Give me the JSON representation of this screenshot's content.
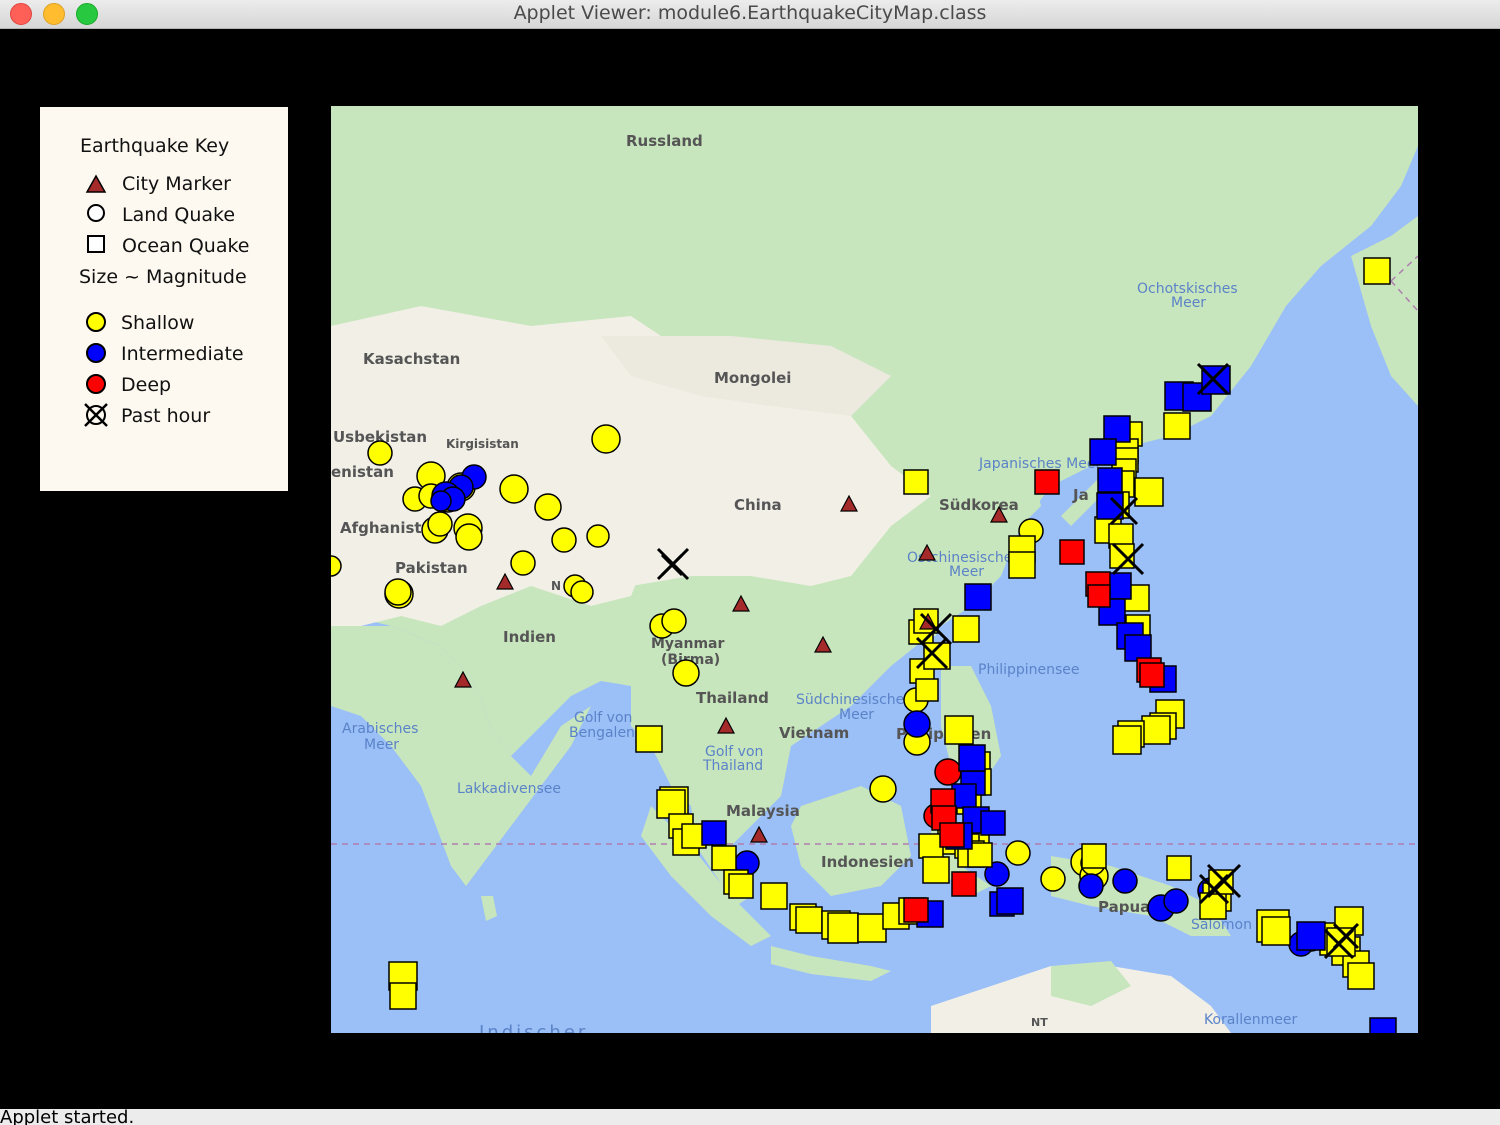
{
  "window": {
    "title": "Applet Viewer: module6.EarthquakeCityMap.class",
    "status": "Applet started."
  },
  "legend": {
    "title": "Earthquake Key",
    "items": [
      {
        "label": "City Marker",
        "icon": "city-marker-icon"
      },
      {
        "label": "Land Quake",
        "icon": "land-quake-icon"
      },
      {
        "label": "Ocean Quake",
        "icon": "ocean-quake-icon"
      }
    ],
    "size_label": "Size ~ Magnitude",
    "depth_items": [
      {
        "label": "Shallow",
        "color": "#ffff00"
      },
      {
        "label": "Intermediate",
        "color": "#0000ff"
      },
      {
        "label": "Deep",
        "color": "#ff0000"
      }
    ],
    "past_hour_label": "Past hour"
  },
  "map": {
    "labels": {
      "russland": "Russland",
      "kasachstan": "Kasachstan",
      "mongolei": "Mongolei",
      "usbekistan": "Usbekistan",
      "kirgisistan": "Kirgisistan",
      "turkmenistan": "enistan",
      "afghanistan": "Afghanista",
      "china": "China",
      "pakistan": "Pakistan",
      "nepal": "N",
      "indien": "Indien",
      "myanmar": "Myanmar\n(Birma)",
      "thailand": "Thailand",
      "vietnam": "Vietnam",
      "malaysia": "Malaysia",
      "indonesien": "Indonesien",
      "suedkorea": "Südkorea",
      "japan": "Ja",
      "philippinen": "Philippinen",
      "papua": "Papua",
      "salomonen": "Salomon",
      "nt": "NT",
      "ochotskisches": "Ochotskisches\nMeer",
      "japanisches": "Japanisches Meer",
      "ostchinesisches": "Ostchinesisches\nMeer",
      "philippinensee": "Philippinensee",
      "suedchinesisches": "Südchinesisches\nMeer",
      "arabisches": "Arabisches\nMeer",
      "golf_bengalen": "Golf von\nBengalen",
      "golf_thailand": "Golf von\nThailand",
      "lakkadivensee": "Lakkadivensee",
      "korallenmeer": "Korallenmeer",
      "indischer": "Indischer"
    }
  }
}
